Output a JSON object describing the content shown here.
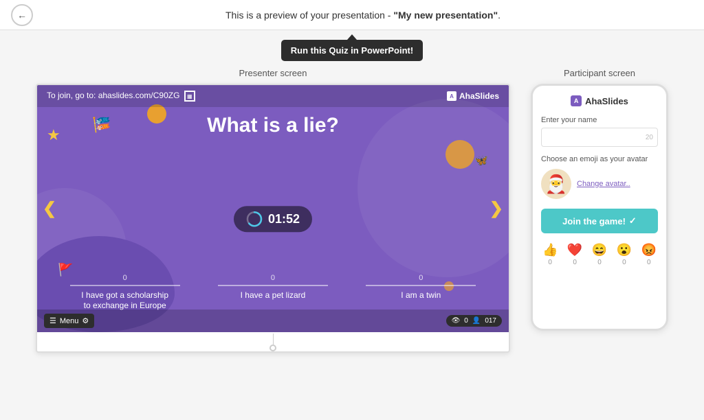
{
  "topBar": {
    "previewText": "This is a preview of your presentation - ",
    "presentationName": "\"My new presentation\"",
    "punctuation": "."
  },
  "tooltip": {
    "buttonLabel": "Run this Quiz in PowerPoint!"
  },
  "presenterSection": {
    "label": "Presenter screen",
    "joinText": "To join, go to: ahaslides.com/C90ZG",
    "logoText": "AhaSlides",
    "questionTitle": "What is a lie?",
    "timer": "01:52",
    "answers": [
      {
        "count": "0",
        "text": "I have got a scholarship\nto exchange in Europe"
      },
      {
        "count": "0",
        "text": "I have a pet lizard"
      },
      {
        "count": "0",
        "text": "I am a twin"
      }
    ],
    "menuLabel": "Menu",
    "viewerCount": "0",
    "playerCount": "017"
  },
  "participantSection": {
    "label": "Participant screen",
    "logoText": "AhaSlides",
    "nameLabel": "Enter your name",
    "inputCount": "20",
    "avatarLabel": "Choose an emoji as your avatar",
    "changeAvatarLink": "Change avatar..",
    "joinButtonLabel": "Join the game!",
    "reactions": [
      {
        "emoji": "👍",
        "count": "0"
      },
      {
        "emoji": "❤️",
        "count": "0"
      },
      {
        "emoji": "😄",
        "count": "0"
      },
      {
        "emoji": "😮",
        "count": "0"
      },
      {
        "emoji": "😡",
        "count": "0"
      }
    ]
  }
}
